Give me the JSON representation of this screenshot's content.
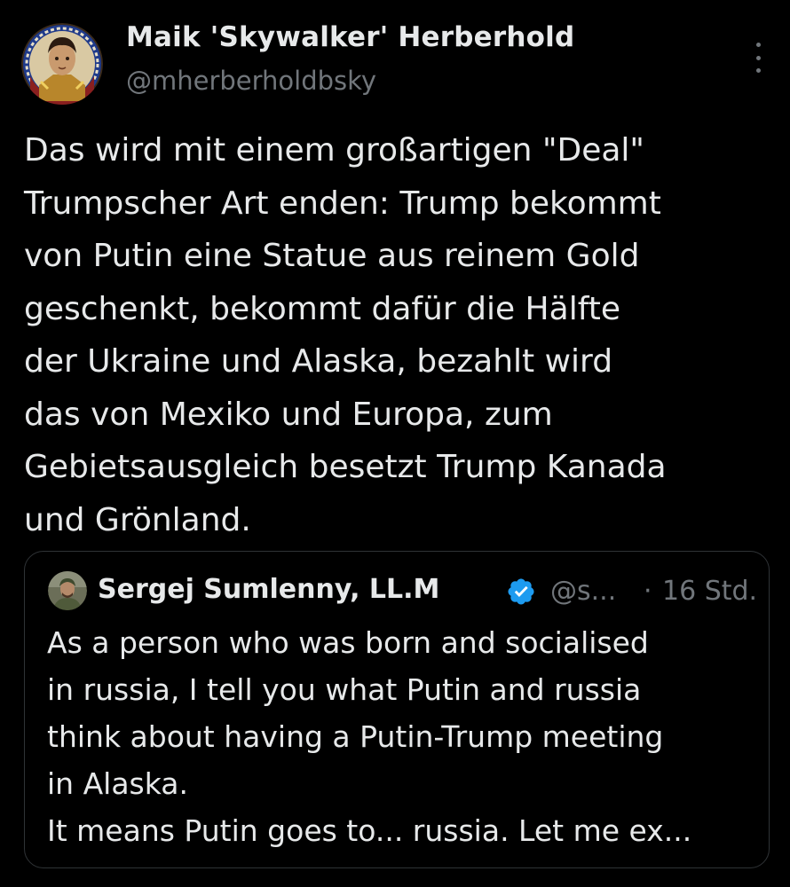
{
  "author": {
    "display_name": "Maik 'Skywalker' Herberhold",
    "handle": "@mherberholdbsky",
    "avatar_icon": "stained-glass-portrait-avatar"
  },
  "more_icon": "vertical-ellipsis-icon",
  "post": {
    "lines": [
      "Das wird mit einem großartigen \"Deal\"",
      "Trumpscher Art enden: Trump bekommt",
      "von Putin eine Statue aus reinem Gold",
      "geschenkt, bekommt dafür die Hälfte",
      "der Ukraine und Alaska, bezahlt wird",
      "das von Mexiko und Europa, zum",
      "Gebietsausgleich besetzt Trump Kanada",
      "und Grönland."
    ]
  },
  "quote": {
    "display_name": "Sergej Sumlenny, LL.M",
    "verified_icon": "verified-badge-icon",
    "handle": "@s...",
    "separator": "·",
    "time": "16 Std.",
    "lines": [
      "As a person who was born and socialised",
      "in russia, I tell you what Putin and russia",
      "think about having a Putin-Trump meeting",
      "in Alaska.",
      "It means Putin goes to... russia. Let me ex..."
    ]
  },
  "colors": {
    "background": "#000000",
    "text_primary": "#e7e9ea",
    "text_secondary": "#71767b",
    "border": "#2f3336",
    "verified_blue": "#1d9bf0"
  }
}
